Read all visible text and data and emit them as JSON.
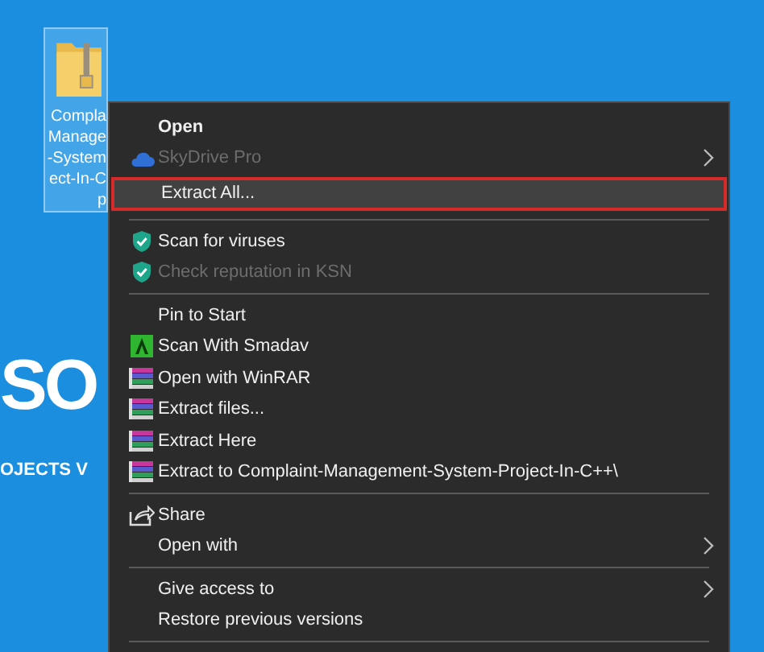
{
  "desktop_icon": {
    "label_lines": [
      "Compla",
      "Manage",
      "-System",
      "ect-In-C",
      "p"
    ],
    "selected": true
  },
  "background_text": {
    "headline": "SO",
    "subline": "OJECTS V"
  },
  "context_menu": {
    "items": [
      {
        "kind": "plain",
        "label": "Open",
        "default": true,
        "disabled": false,
        "selected": false,
        "submenu": false
      },
      {
        "kind": "cloud",
        "label": "SkyDrive Pro",
        "default": false,
        "disabled": true,
        "selected": false,
        "submenu": true
      },
      {
        "kind": "plain",
        "label": "Extract All...",
        "default": false,
        "disabled": false,
        "selected": true,
        "submenu": false
      },
      {
        "kind": "separator"
      },
      {
        "kind": "shield",
        "label": "Scan for viruses",
        "default": false,
        "disabled": false,
        "selected": false,
        "submenu": false
      },
      {
        "kind": "shield",
        "label": "Check reputation in KSN",
        "default": false,
        "disabled": true,
        "selected": false,
        "submenu": false
      },
      {
        "kind": "separator"
      },
      {
        "kind": "plain",
        "label": "Pin to Start",
        "default": false,
        "disabled": false,
        "selected": false,
        "submenu": false
      },
      {
        "kind": "smadav",
        "label": "Scan With Smadav",
        "default": false,
        "disabled": false,
        "selected": false,
        "submenu": false
      },
      {
        "kind": "winrar",
        "label": "Open with WinRAR",
        "default": false,
        "disabled": false,
        "selected": false,
        "submenu": false
      },
      {
        "kind": "winrar",
        "label": "Extract files...",
        "default": false,
        "disabled": false,
        "selected": false,
        "submenu": false
      },
      {
        "kind": "winrar",
        "label": "Extract Here",
        "default": false,
        "disabled": false,
        "selected": false,
        "submenu": false
      },
      {
        "kind": "winrar",
        "label": "Extract to Complaint-Management-System-Project-In-C++\\",
        "default": false,
        "disabled": false,
        "selected": false,
        "submenu": false
      },
      {
        "kind": "separator"
      },
      {
        "kind": "share",
        "label": "Share",
        "default": false,
        "disabled": false,
        "selected": false,
        "submenu": false
      },
      {
        "kind": "plain",
        "label": "Open with",
        "default": false,
        "disabled": false,
        "selected": false,
        "submenu": true
      },
      {
        "kind": "separator"
      },
      {
        "kind": "plain",
        "label": "Give access to",
        "default": false,
        "disabled": false,
        "selected": false,
        "submenu": true
      },
      {
        "kind": "plain",
        "label": "Restore previous versions",
        "default": false,
        "disabled": false,
        "selected": false,
        "submenu": false
      },
      {
        "kind": "separator"
      }
    ]
  }
}
